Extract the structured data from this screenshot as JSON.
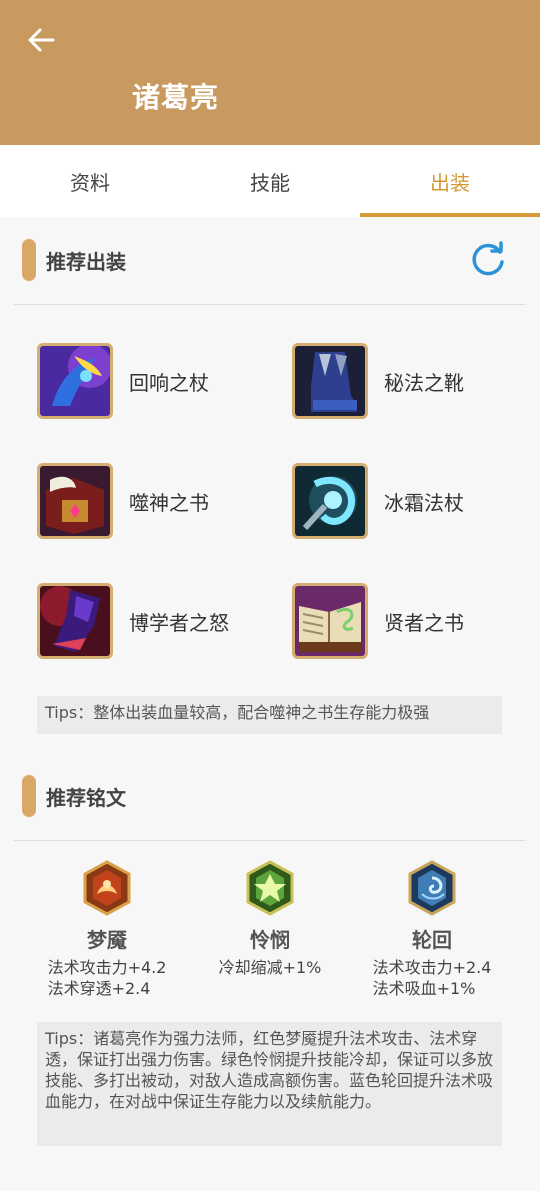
{
  "header": {
    "back_icon": "arrow-left-icon",
    "title": "诸葛亮"
  },
  "tabs": [
    {
      "label": "资料",
      "active": false
    },
    {
      "label": "技能",
      "active": false
    },
    {
      "label": "出装",
      "active": true
    }
  ],
  "equipment": {
    "title": "推荐出装",
    "refresh_icon": "refresh-icon",
    "items": [
      {
        "name": "回响之杖",
        "icon": "echo-staff-icon"
      },
      {
        "name": "秘法之靴",
        "icon": "arcane-boots-icon"
      },
      {
        "name": "噬神之书",
        "icon": "god-devouring-book-icon"
      },
      {
        "name": "冰霜法杖",
        "icon": "frost-staff-icon"
      },
      {
        "name": "博学者之怒",
        "icon": "scholars-fury-icon"
      },
      {
        "name": "贤者之书",
        "icon": "sages-book-icon"
      }
    ],
    "tips": "Tips：整体出装血量较高，配合噬神之书生存能力极强"
  },
  "runes": {
    "title": "推荐铭文",
    "items": [
      {
        "name": "梦魇",
        "icon": "red-rune-icon",
        "stats": [
          "法术攻击力+4.2",
          "法术穿透+2.4"
        ],
        "color": "#c0431c"
      },
      {
        "name": "怜悯",
        "icon": "green-rune-icon",
        "stats": [
          "冷却缩减+1%"
        ],
        "color": "#5ba53a"
      },
      {
        "name": "轮回",
        "icon": "blue-rune-icon",
        "stats": [
          "法术攻击力+2.4",
          "法术吸血+1%"
        ],
        "color": "#3f7db4"
      }
    ],
    "tips": "Tips：诸葛亮作为强力法师，红色梦魇提升法术攻击、法术穿透，保证打出强力伤害。绿色怜悯提升技能冷却，保证可以多放技能、多打出被动，对敌人造成高额伤害。蓝色轮回提升法术吸血能力，在对战中保证生存能力以及续航能力。"
  },
  "colors": {
    "header": "#c99a60",
    "accent": "#d49a36",
    "refresh": "#2d93d6"
  }
}
